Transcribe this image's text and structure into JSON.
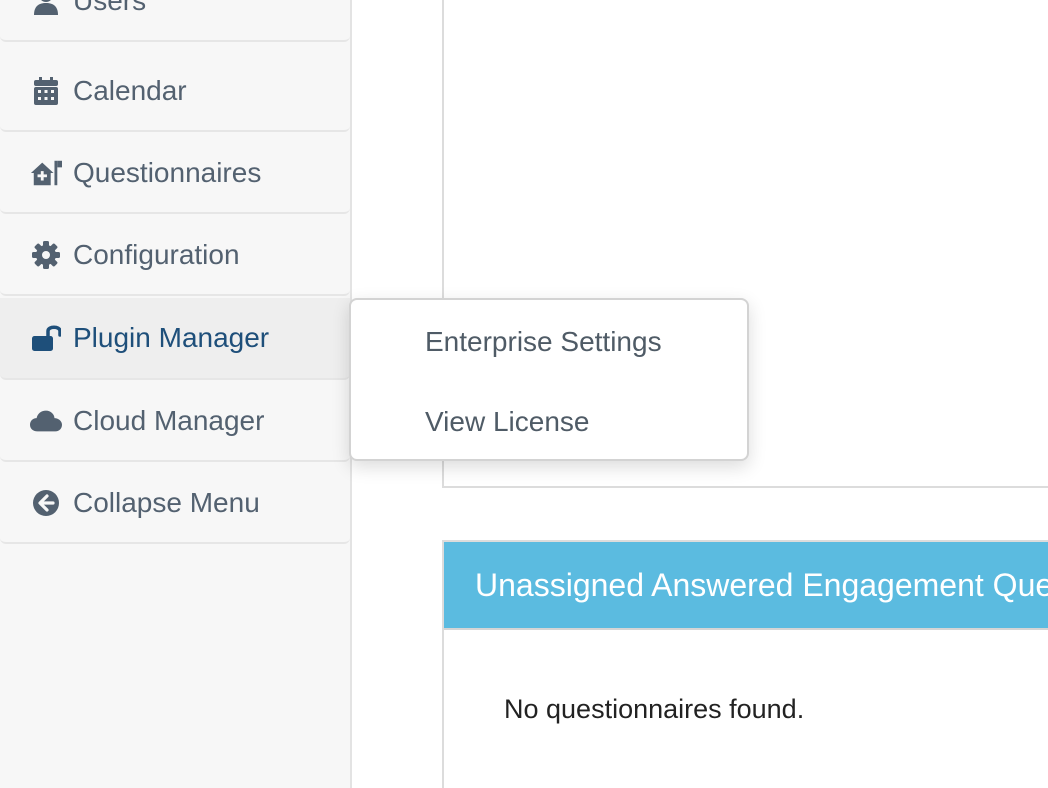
{
  "sidebar": {
    "items": [
      {
        "label": "Users",
        "icon": "user-icon"
      },
      {
        "label": "Calendar",
        "icon": "calendar-icon"
      },
      {
        "label": "Questionnaires",
        "icon": "house-medical-flag-icon"
      },
      {
        "label": "Configuration",
        "icon": "gear-icon"
      },
      {
        "label": "Plugin Manager",
        "icon": "unlock-icon",
        "active": true
      },
      {
        "label": "Cloud Manager",
        "icon": "cloud-icon"
      },
      {
        "label": "Collapse Menu",
        "icon": "circle-arrow-left-icon"
      }
    ]
  },
  "dropdown": {
    "items": [
      {
        "label": "Enterprise Settings"
      },
      {
        "label": "View License"
      }
    ]
  },
  "main": {
    "panel_title": "Unassigned Answered Engagement Questionnaires",
    "empty_message": "No questionnaires found."
  },
  "colors": {
    "sidebar_bg": "#f7f7f7",
    "sidebar_text": "#536170",
    "active_text": "#1e4f7a",
    "header_bg": "#5bbbe0"
  }
}
